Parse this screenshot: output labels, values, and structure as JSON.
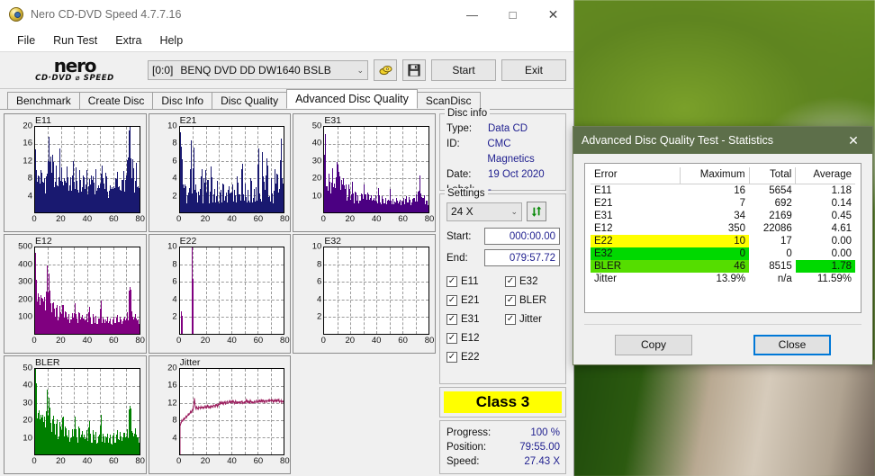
{
  "window": {
    "title": "Nero CD-DVD Speed 4.7.7.16",
    "icon": "nero-disc-icon",
    "minimize": "—",
    "maximize": "□",
    "close": "✕"
  },
  "menu": [
    "File",
    "Run Test",
    "Extra",
    "Help"
  ],
  "logo": {
    "line1": "nero",
    "line2": "CD·DVD ⌀ SPEED"
  },
  "toolbar": {
    "drive_id": "[0:0]",
    "drive_name": "BENQ DVD DD DW1640 BSLB",
    "caret": "⌄",
    "eject_icon": "eject-disc-icon",
    "save_icon": "floppy-save-icon",
    "start_label": "Start",
    "exit_label": "Exit"
  },
  "tabs": [
    {
      "label": "Benchmark",
      "active": false
    },
    {
      "label": "Create Disc",
      "active": false
    },
    {
      "label": "Disc Info",
      "active": false
    },
    {
      "label": "Disc Quality",
      "active": false
    },
    {
      "label": "Advanced Disc Quality",
      "active": true
    },
    {
      "label": "ScanDisc",
      "active": false
    }
  ],
  "disc_info": {
    "legend": "Disc info",
    "rows": [
      {
        "key": "Type:",
        "value": "Data CD"
      },
      {
        "key": "ID:",
        "value": "CMC Magnetics"
      },
      {
        "key": "Date:",
        "value": "19 Oct 2020"
      },
      {
        "key": "Label:",
        "value": "-"
      }
    ]
  },
  "settings": {
    "legend": "Settings",
    "speed": "24 X",
    "caret": "⌄",
    "refresh_icon": "refresh-arrows-icon",
    "start_label": "Start:",
    "start_value": "000:00.00",
    "end_label": "End:",
    "end_value": "079:57.72",
    "checkmark": "✓",
    "checkboxes": [
      {
        "label": "E11",
        "checked": true
      },
      {
        "label": "E32",
        "checked": true
      },
      {
        "label": "E21",
        "checked": true
      },
      {
        "label": "BLER",
        "checked": true
      },
      {
        "label": "E31",
        "checked": true
      },
      {
        "label": "Jitter",
        "checked": true
      },
      {
        "label": "E12",
        "checked": true
      },
      {
        "label": "",
        "checked": null
      },
      {
        "label": "E22",
        "checked": true
      },
      {
        "label": "",
        "checked": null
      }
    ]
  },
  "class_badge": {
    "label": "Class 3",
    "color": "#ffff00"
  },
  "progress": {
    "rows": [
      {
        "key": "Progress:",
        "value": "100 %"
      },
      {
        "key": "Position:",
        "value": "79:55.00"
      },
      {
        "key": "Speed:",
        "value": "27.43 X"
      }
    ]
  },
  "dialog": {
    "title": "Advanced Disc Quality Test - Statistics",
    "close": "✕",
    "headers": [
      "Error",
      "Maximum",
      "Total",
      "Average"
    ],
    "rows": [
      {
        "error": "E11",
        "maximum": "16",
        "total": "5654",
        "average": "1.18",
        "row_hl": "",
        "avg_hl": ""
      },
      {
        "error": "E21",
        "maximum": "7",
        "total": "692",
        "average": "0.14",
        "row_hl": "",
        "avg_hl": ""
      },
      {
        "error": "E31",
        "maximum": "34",
        "total": "2169",
        "average": "0.45",
        "row_hl": "",
        "avg_hl": ""
      },
      {
        "error": "E12",
        "maximum": "350",
        "total": "22086",
        "average": "4.61",
        "row_hl": "",
        "avg_hl": ""
      },
      {
        "error": "E22",
        "maximum": "10",
        "total": "17",
        "average": "0.00",
        "row_hl": "#ffff00",
        "avg_hl": ""
      },
      {
        "error": "E32",
        "maximum": "0",
        "total": "0",
        "average": "0.00",
        "row_hl": "#00d900",
        "avg_hl": ""
      },
      {
        "error": "BLER",
        "maximum": "46",
        "total": "8515",
        "average": "1.78",
        "row_hl": "#55dd00",
        "avg_hl": "#00d900"
      },
      {
        "error": "Jitter",
        "maximum": "13.9%",
        "total": "n/a",
        "average": "11.59%",
        "row_hl": "",
        "avg_hl": ""
      }
    ],
    "copy_label": "Copy",
    "close_label": "Close"
  },
  "chart_data": [
    {
      "type": "bar",
      "name": "E11",
      "title": "E11",
      "color": "#191970",
      "ylim": [
        0,
        20
      ],
      "yticks": [
        4,
        8,
        12,
        16,
        20
      ],
      "xlim": [
        0,
        80
      ],
      "xticks": [
        0,
        20,
        40,
        60,
        80
      ],
      "xlabel": "",
      "ylabel": "",
      "grid": true,
      "baseline": 3.5,
      "peak_max": 16,
      "peak_x": 10,
      "values": [
        11,
        7,
        8,
        6,
        9,
        5,
        7,
        4,
        6,
        8,
        14,
        9,
        12,
        10,
        6,
        8,
        5,
        7,
        11,
        6,
        9,
        5,
        7,
        6,
        8,
        4,
        6,
        5,
        7,
        9,
        5,
        8,
        6,
        4,
        7,
        5,
        6,
        8,
        5,
        7,
        4,
        6,
        5,
        8,
        6,
        4,
        7,
        5,
        6,
        4,
        8,
        9,
        6,
        5,
        7,
        4,
        3,
        5,
        6,
        4,
        5,
        7,
        6,
        8,
        5,
        4,
        6,
        7,
        5,
        6,
        9,
        12,
        16,
        10,
        7,
        9,
        5,
        8,
        6,
        5
      ]
    },
    {
      "type": "bar",
      "name": "E21",
      "title": "E21",
      "color": "#191970",
      "ylim": [
        0,
        10
      ],
      "yticks": [
        2,
        4,
        6,
        8,
        10
      ],
      "xlim": [
        0,
        80
      ],
      "xticks": [
        0,
        20,
        40,
        60,
        80
      ],
      "xlabel": "",
      "ylabel": "",
      "grid": true,
      "baseline": 1.2,
      "peak_max": 7,
      "peak_x": 1,
      "values": [
        7,
        6,
        3,
        2,
        3,
        1,
        2,
        3,
        6,
        2,
        6,
        2,
        3,
        1,
        2,
        2,
        4,
        1,
        3,
        4,
        2,
        3,
        1,
        2,
        4,
        1,
        2,
        1,
        3,
        1,
        1,
        2,
        1,
        3,
        1,
        2,
        1,
        3,
        2,
        1,
        3,
        1,
        2,
        1,
        3,
        2,
        1,
        5,
        2,
        1,
        3,
        1,
        2,
        1,
        3,
        1,
        2,
        1,
        3,
        1,
        6,
        2,
        1,
        6,
        3,
        2,
        5,
        4,
        2,
        1,
        3,
        1,
        2,
        4,
        4,
        2,
        3,
        6,
        4,
        3
      ]
    },
    {
      "type": "bar",
      "name": "E31",
      "title": "E31",
      "color": "#4b0082",
      "ylim": [
        0,
        50
      ],
      "yticks": [
        10,
        20,
        30,
        40,
        50
      ],
      "xlim": [
        0,
        80
      ],
      "xticks": [
        0,
        20,
        40,
        60,
        80
      ],
      "xlabel": "",
      "ylabel": "",
      "grid": true,
      "baseline": 5,
      "peak_max": 34,
      "peak_x": 0,
      "values": [
        34,
        12,
        14,
        16,
        11,
        18,
        13,
        15,
        10,
        26,
        22,
        18,
        12,
        14,
        16,
        10,
        13,
        8,
        12,
        11,
        9,
        14,
        7,
        10,
        6,
        8,
        5,
        7,
        9,
        6,
        15,
        8,
        6,
        10,
        7,
        9,
        5,
        8,
        6,
        7,
        5,
        11,
        6,
        4,
        7,
        5,
        6,
        4,
        7,
        5,
        12,
        4,
        6,
        3,
        5,
        7,
        4,
        6,
        3,
        5,
        7,
        4,
        6,
        8,
        5,
        7,
        4,
        6,
        9,
        5,
        8,
        6,
        10,
        17,
        8,
        6,
        9,
        5,
        7,
        4
      ]
    },
    {
      "type": "bar",
      "name": "E12",
      "title": "E12",
      "color": "#800080",
      "ylim": [
        0,
        500
      ],
      "yticks": [
        100,
        200,
        300,
        400,
        500
      ],
      "xlim": [
        0,
        80
      ],
      "xticks": [
        0,
        20,
        40,
        60,
        80
      ],
      "xlabel": "",
      "ylabel": "",
      "grid": true,
      "baseline": 60,
      "peak_max": 350,
      "peak_x": 10,
      "values": [
        350,
        180,
        215,
        150,
        200,
        140,
        185,
        120,
        175,
        350,
        275,
        190,
        160,
        130,
        145,
        110,
        130,
        90,
        120,
        100,
        95,
        130,
        80,
        105,
        70,
        90,
        60,
        80,
        95,
        70,
        160,
        85,
        70,
        110,
        75,
        95,
        60,
        85,
        70,
        80,
        60,
        120,
        70,
        50,
        80,
        60,
        70,
        50,
        80,
        60,
        170,
        50,
        70,
        40,
        60,
        80,
        45,
        70,
        40,
        60,
        80,
        45,
        70,
        90,
        55,
        75,
        45,
        65,
        100,
        60,
        90,
        70,
        210,
        200,
        90,
        70,
        100,
        60,
        80,
        50
      ]
    },
    {
      "type": "bar",
      "name": "E22",
      "title": "E22",
      "color": "#800080",
      "ylim": [
        0,
        10
      ],
      "yticks": [
        2,
        4,
        6,
        8,
        10
      ],
      "xlim": [
        0,
        80
      ],
      "xticks": [
        0,
        20,
        40,
        60,
        80
      ],
      "xlabel": "",
      "ylabel": "",
      "grid": true,
      "baseline": 0,
      "peak_max": 10,
      "peak_x": 9,
      "values": [
        0,
        2,
        0,
        0,
        0,
        0,
        0,
        0,
        0,
        10,
        0,
        0,
        0,
        0,
        0,
        0,
        0,
        0,
        0,
        0,
        0,
        0,
        0,
        0,
        0,
        0,
        0,
        0,
        0,
        0,
        0,
        0,
        0,
        0,
        0,
        0,
        0,
        0,
        0,
        0,
        0,
        0,
        0,
        0,
        0,
        0,
        0,
        0,
        0,
        0,
        0,
        0,
        0,
        0,
        0,
        0,
        0,
        0,
        0,
        0,
        0,
        0,
        0,
        0,
        0,
        0,
        0,
        0,
        0,
        0,
        0,
        0,
        0,
        0,
        0,
        0,
        0,
        0,
        0,
        0
      ]
    },
    {
      "type": "bar",
      "name": "E32",
      "title": "E32",
      "color": "#800080",
      "ylim": [
        0,
        10
      ],
      "yticks": [
        2,
        4,
        6,
        8,
        10
      ],
      "xlim": [
        0,
        80
      ],
      "xticks": [
        0,
        20,
        40,
        60,
        80
      ],
      "xlabel": "",
      "ylabel": "",
      "grid": true,
      "baseline": 0,
      "peak_max": 0,
      "peak_x": 0,
      "values": [
        0,
        0,
        0,
        0,
        0,
        0,
        0,
        0,
        0,
        0,
        0,
        0,
        0,
        0,
        0,
        0,
        0,
        0,
        0,
        0,
        0,
        0,
        0,
        0,
        0,
        0,
        0,
        0,
        0,
        0,
        0,
        0,
        0,
        0,
        0,
        0,
        0,
        0,
        0,
        0,
        0,
        0,
        0,
        0,
        0,
        0,
        0,
        0,
        0,
        0,
        0,
        0,
        0,
        0,
        0,
        0,
        0,
        0,
        0,
        0,
        0,
        0,
        0,
        0,
        0,
        0,
        0,
        0,
        0,
        0,
        0,
        0,
        0,
        0,
        0,
        0,
        0,
        0,
        0,
        0
      ]
    },
    {
      "type": "bar",
      "name": "BLER",
      "title": "BLER",
      "color": "#008000",
      "ylim": [
        0,
        50
      ],
      "yticks": [
        10,
        20,
        30,
        40,
        50
      ],
      "xlim": [
        0,
        80
      ],
      "xticks": [
        0,
        20,
        40,
        60,
        80
      ],
      "xlabel": "",
      "ylabel": "",
      "grid": true,
      "baseline": 7,
      "peak_max": 46,
      "peak_x": 0,
      "values": [
        46,
        20,
        22,
        18,
        21,
        16,
        19,
        14,
        18,
        33,
        26,
        21,
        17,
        15,
        18,
        13,
        16,
        10,
        14,
        13,
        12,
        17,
        9,
        13,
        8,
        11,
        7,
        10,
        12,
        8,
        20,
        11,
        8,
        14,
        9,
        12,
        7,
        11,
        8,
        10,
        7,
        15,
        9,
        6,
        10,
        8,
        9,
        6,
        10,
        8,
        20,
        6,
        9,
        5,
        8,
        10,
        6,
        9,
        5,
        8,
        10,
        6,
        9,
        12,
        7,
        10,
        6,
        9,
        13,
        8,
        11,
        9,
        22,
        21,
        11,
        9,
        13,
        8,
        10,
        6
      ]
    },
    {
      "type": "line",
      "name": "Jitter",
      "title": "Jitter",
      "color": "#9c1f5f",
      "ylim": [
        0,
        20
      ],
      "yticks": [
        4,
        8,
        12,
        16,
        20
      ],
      "xlim": [
        0,
        80
      ],
      "xticks": [
        0,
        20,
        40,
        60,
        80
      ],
      "xlabel": "",
      "ylabel": "",
      "grid": true,
      "peak_max": 13.9,
      "average": 11.59,
      "values": [
        7.0,
        7.6,
        8.0,
        8.3,
        8.6,
        8.9,
        9.2,
        9.5,
        9.8,
        10.1,
        10.5,
        13.0,
        10.8,
        11.0,
        10.7,
        11.1,
        10.9,
        11.2,
        10.8,
        11.3,
        11.0,
        11.4,
        11.1,
        11.0,
        11.3,
        11.2,
        11.5,
        11.3,
        11.6,
        11.4,
        11.8,
        12.0,
        12.1,
        11.9,
        12.2,
        12.0,
        12.3,
        12.1,
        12.4,
        12.2,
        12.5,
        12.3,
        12.1,
        12.4,
        12.0,
        12.3,
        12.1,
        12.4,
        12.2,
        12.0,
        12.3,
        12.6,
        12.4,
        12.2,
        12.5,
        12.3,
        12.0,
        12.4,
        12.2,
        12.5,
        12.3,
        12.6,
        12.4,
        12.7,
        12.5,
        12.3,
        12.6,
        12.4,
        12.7,
        12.5,
        12.8,
        12.6,
        12.4,
        12.7,
        12.5,
        12.8,
        12.6,
        12.4,
        12.5,
        12.3
      ]
    }
  ]
}
